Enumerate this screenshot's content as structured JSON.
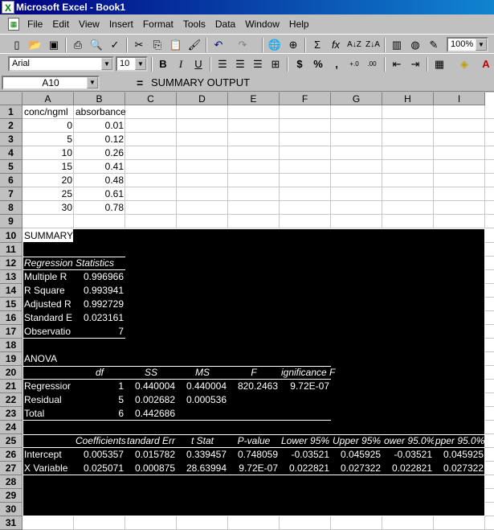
{
  "window": {
    "title": "Microsoft Excel - Book1"
  },
  "menu": [
    "File",
    "Edit",
    "View",
    "Insert",
    "Format",
    "Tools",
    "Data",
    "Window",
    "Help"
  ],
  "toolbar": {
    "zoom": "100%",
    "font_name": "Arial",
    "font_size": "10"
  },
  "formula_bar": {
    "name_box": "A10",
    "equals": "=",
    "content": "SUMMARY OUTPUT"
  },
  "columns": [
    "A",
    "B",
    "C",
    "D",
    "E",
    "F",
    "G",
    "H",
    "I"
  ],
  "rows": [
    "1",
    "2",
    "3",
    "4",
    "5",
    "6",
    "7",
    "8",
    "9",
    "10",
    "11",
    "12",
    "13",
    "14",
    "15",
    "16",
    "17",
    "18",
    "19",
    "20",
    "21",
    "22",
    "23",
    "24",
    "25",
    "26",
    "27",
    "28",
    "29",
    "30",
    "31"
  ],
  "data_table": {
    "header": [
      "conc/ngml",
      "absorbance"
    ],
    "rows": [
      [
        "0",
        "0.01"
      ],
      [
        "5",
        "0.12"
      ],
      [
        "10",
        "0.26"
      ],
      [
        "15",
        "0.41"
      ],
      [
        "20",
        "0.48"
      ],
      [
        "25",
        "0.61"
      ],
      [
        "30",
        "0.78"
      ]
    ]
  },
  "summary": {
    "title": "SUMMARY OUTPUT",
    "reg_stats_header": [
      "Regression",
      "Statistics"
    ],
    "reg_stats": [
      [
        "Multiple R",
        "0.996966"
      ],
      [
        "R Square",
        "0.993941"
      ],
      [
        "Adjusted R",
        "0.992729"
      ],
      [
        "Standard E",
        "0.023161"
      ],
      [
        "Observatio",
        "7"
      ]
    ],
    "anova_title": "ANOVA",
    "anova_header": [
      "df",
      "SS",
      "MS",
      "F",
      "ignificance F"
    ],
    "anova_rows": [
      [
        "Regressior",
        "1",
        "0.440004",
        "0.440004",
        "820.2463",
        "9.72E-07"
      ],
      [
        "Residual",
        "5",
        "0.002682",
        "0.000536",
        "",
        ""
      ],
      [
        "Total",
        "6",
        "0.442686",
        "",
        "",
        ""
      ]
    ],
    "coef_header": [
      "Coefficients",
      "tandard Err",
      "t Stat",
      "P-value",
      "Lower 95%",
      "Upper 95%",
      "ower 95.0%",
      "pper 95.0%"
    ],
    "coef_rows": [
      [
        "Intercept",
        "0.005357",
        "0.015782",
        "0.339457",
        "0.748059",
        "-0.03521",
        "0.045925",
        "-0.03521",
        "0.045925"
      ],
      [
        "X Variable",
        "0.025071",
        "0.000875",
        "28.63994",
        "9.72E-07",
        "0.022821",
        "0.027322",
        "0.022821",
        "0.027322"
      ]
    ]
  }
}
